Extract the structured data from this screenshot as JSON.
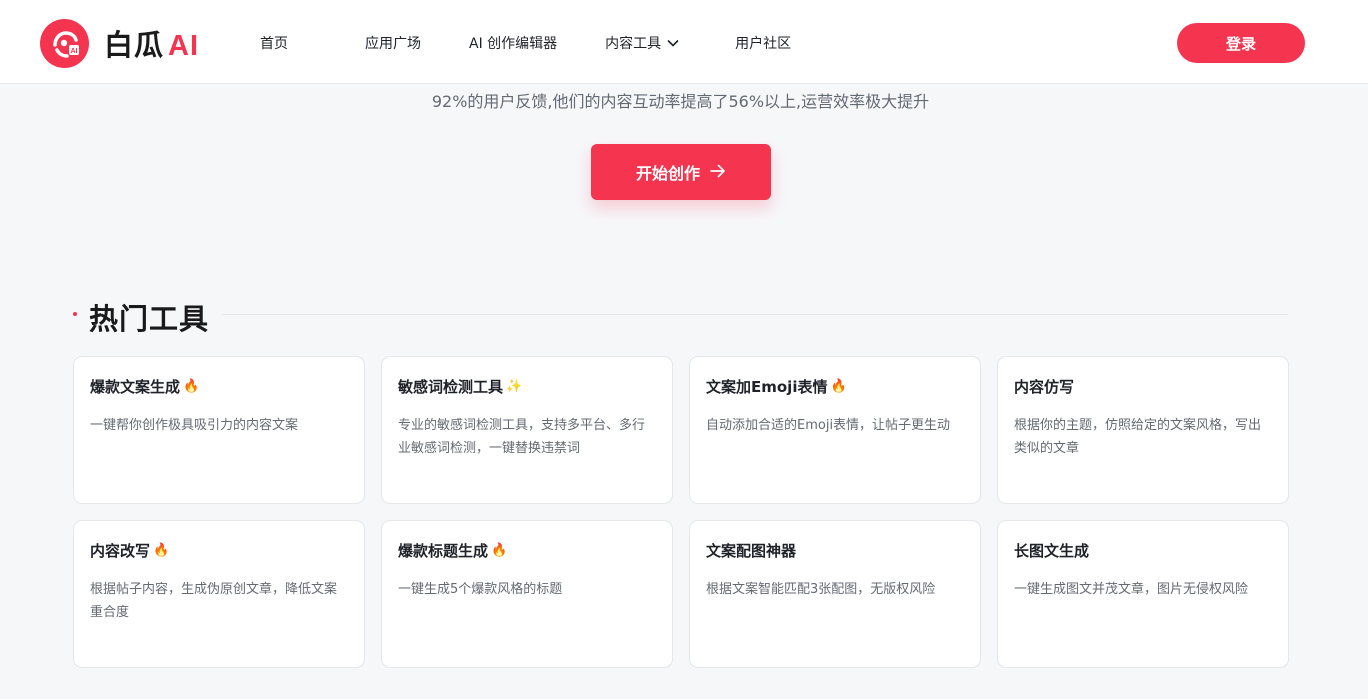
{
  "header": {
    "brand_name": "白瓜",
    "brand_ai": "AI",
    "nav": [
      {
        "label": "首页"
      },
      {
        "label": "应用广场"
      },
      {
        "label": "AI 创作编辑器"
      },
      {
        "label": "内容工具",
        "has_dropdown": true
      },
      {
        "label": "用户社区"
      }
    ],
    "login_label": "登录"
  },
  "hero": {
    "subtitle": "92%的用户反馈,他们的内容互动率提高了56%以上,运营效率极大提升",
    "cta_label": "开始创作"
  },
  "section": {
    "title": "热门工具"
  },
  "tools": [
    {
      "title": "爆款文案生成",
      "emoji": "🔥",
      "desc": "一键帮你创作极具吸引力的内容文案"
    },
    {
      "title": "敏感词检测工具",
      "emoji": "✨",
      "desc": "专业的敏感词检测工具，支持多平台、多行业敏感词检测，一键替换违禁词"
    },
    {
      "title": "文案加Emoji表情",
      "emoji": "🔥",
      "desc": "自动添加合适的Emoji表情，让帖子更生动"
    },
    {
      "title": "内容仿写",
      "emoji": "",
      "desc": "根据你的主题，仿照给定的文案风格，写出类似的文章"
    },
    {
      "title": "内容改写",
      "emoji": "🔥",
      "desc": "根据帖子内容，生成伪原创文章，降低文案重合度"
    },
    {
      "title": "爆款标题生成",
      "emoji": "🔥",
      "desc": "一键生成5个爆款风格的标题"
    },
    {
      "title": "文案配图神器",
      "emoji": "",
      "desc": "根据文案智能匹配3张配图，无版权风险"
    },
    {
      "title": "长图文生成",
      "emoji": "",
      "desc": "一键生成图文并茂文章，图片无侵权风险"
    }
  ],
  "colors": {
    "brand": "#f5344f",
    "background": "#f6f7f9"
  }
}
